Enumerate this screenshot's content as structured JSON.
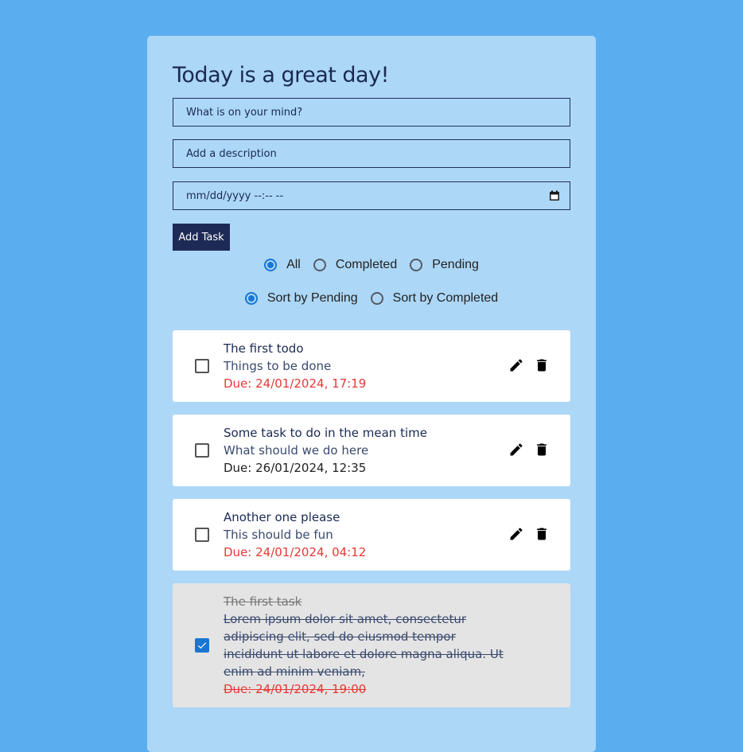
{
  "header": {
    "title": "Today is a great day!"
  },
  "form": {
    "title_placeholder": "What is on your mind?",
    "description_placeholder": "Add a description",
    "date_placeholder": "mm/dd/yyyy --:-- --",
    "add_label": "Add Task"
  },
  "filter": {
    "options": [
      "All",
      "Completed",
      "Pending"
    ],
    "selected": "All"
  },
  "sort": {
    "options": [
      "Sort by Pending",
      "Sort by Completed"
    ],
    "selected": "Sort by Pending"
  },
  "colors": {
    "background": "#5aaeef",
    "card": "#acd7f7",
    "accent": "#1976d2",
    "button": "#1e2a56",
    "overdue": "#e53935"
  },
  "todos": [
    {
      "title": "The first todo",
      "description": "Things to be done",
      "due": "Due: 24/01/2024, 17:19",
      "overdue": true,
      "completed": false,
      "actions": [
        "pencil-icon",
        "trash-icon"
      ]
    },
    {
      "title": "Some task to do in the mean time",
      "description": "What should we do here",
      "due": "Due: 26/01/2024, 12:35",
      "overdue": false,
      "completed": false,
      "actions": [
        "pencil-icon",
        "trash-icon"
      ]
    },
    {
      "title": "Another one please",
      "description": "This should be fun",
      "due": "Due: 24/01/2024, 04:12",
      "overdue": true,
      "completed": false,
      "actions": [
        "pencil-icon",
        "trash-icon"
      ]
    },
    {
      "title": "The first task",
      "description": "Lorem ipsum dolor sit amet, consectetur adipiscing elit, sed do eiusmod tempor incididunt ut labore et dolore magna aliqua. Ut enim ad minim veniam,",
      "due": "Due: 24/01/2024, 19:00",
      "overdue": true,
      "completed": true,
      "actions": []
    }
  ]
}
